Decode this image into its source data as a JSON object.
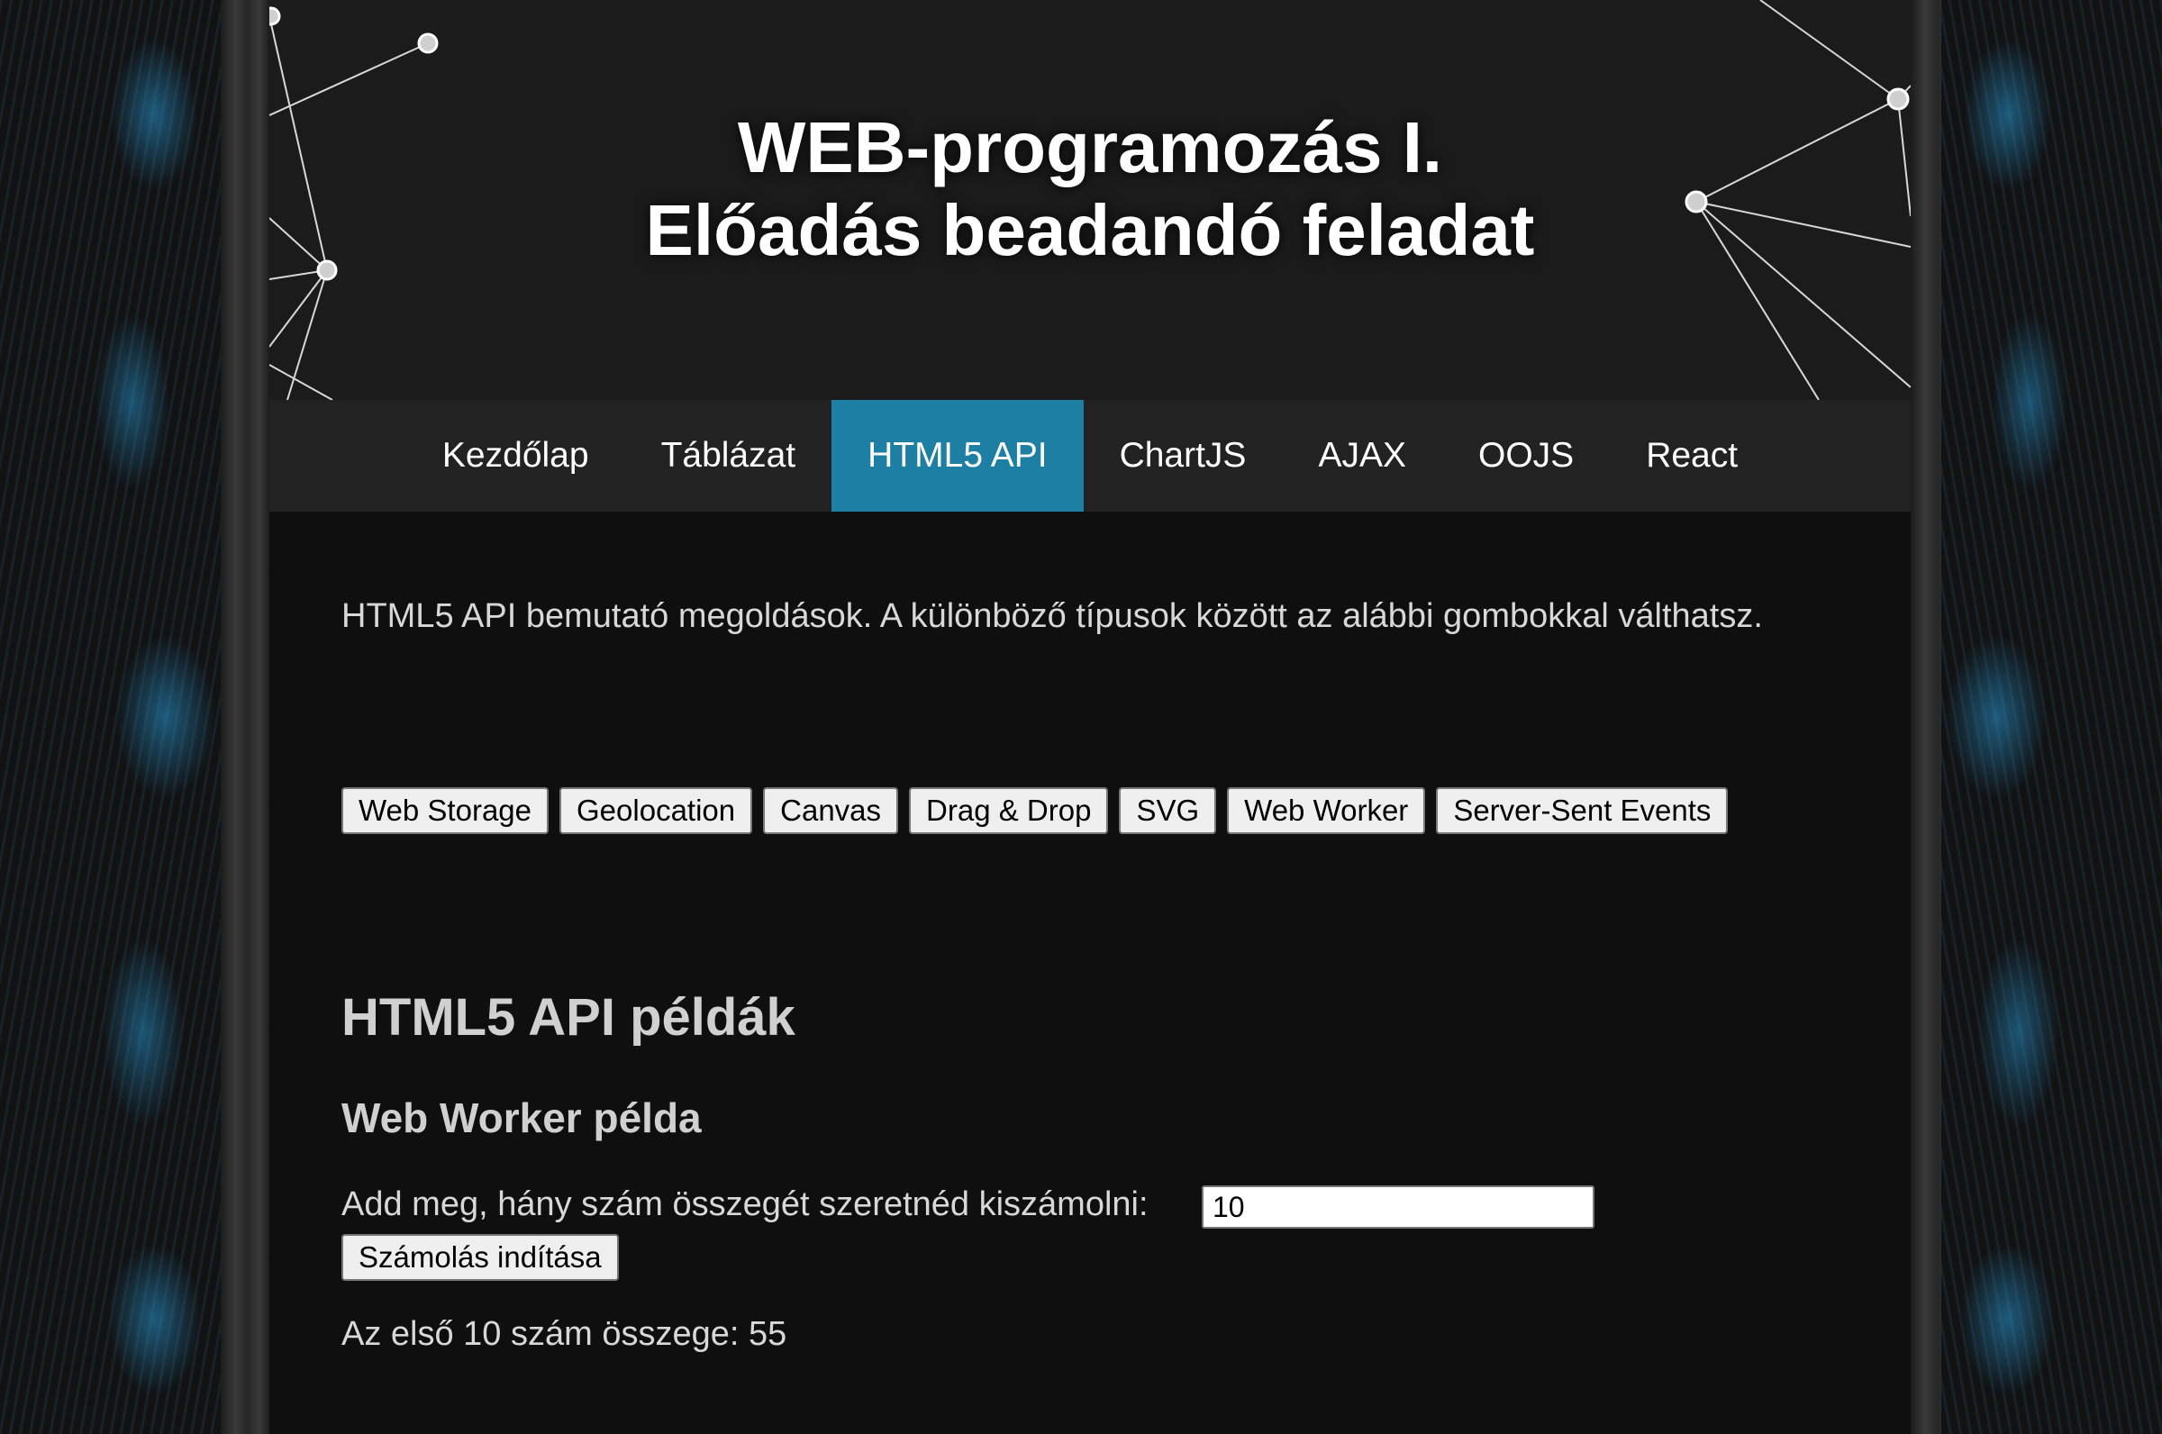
{
  "header": {
    "title_line1": "WEB-programozás I.",
    "title_line2": "Előadás beadandó feladat"
  },
  "nav": {
    "items": [
      {
        "label": "Kezdőlap"
      },
      {
        "label": "Táblázat"
      },
      {
        "label": "HTML5 API",
        "active": true
      },
      {
        "label": "ChartJS"
      },
      {
        "label": "AJAX"
      },
      {
        "label": "OOJS"
      },
      {
        "label": "React"
      }
    ]
  },
  "main": {
    "intro": "HTML5 API bemutató megoldások. A különböző típusok között az alábbi gombokkal válthatsz.",
    "buttons": [
      "Web Storage",
      "Geolocation",
      "Canvas",
      "Drag & Drop",
      "SVG",
      "Web Worker",
      "Server-Sent Events"
    ],
    "heading": "HTML5 API példák",
    "subheading": "Web Worker példa",
    "prompt": "Add meg, hány szám összegét szeretnéd kiszámolni:",
    "input_value": "10",
    "start_button": "Számolás indítása",
    "result": "Az első 10 szám összege: 55"
  },
  "colors": {
    "nav_active": "#1c7fa3",
    "nav_bg": "#222222",
    "page_bg": "#0f0f0f"
  }
}
